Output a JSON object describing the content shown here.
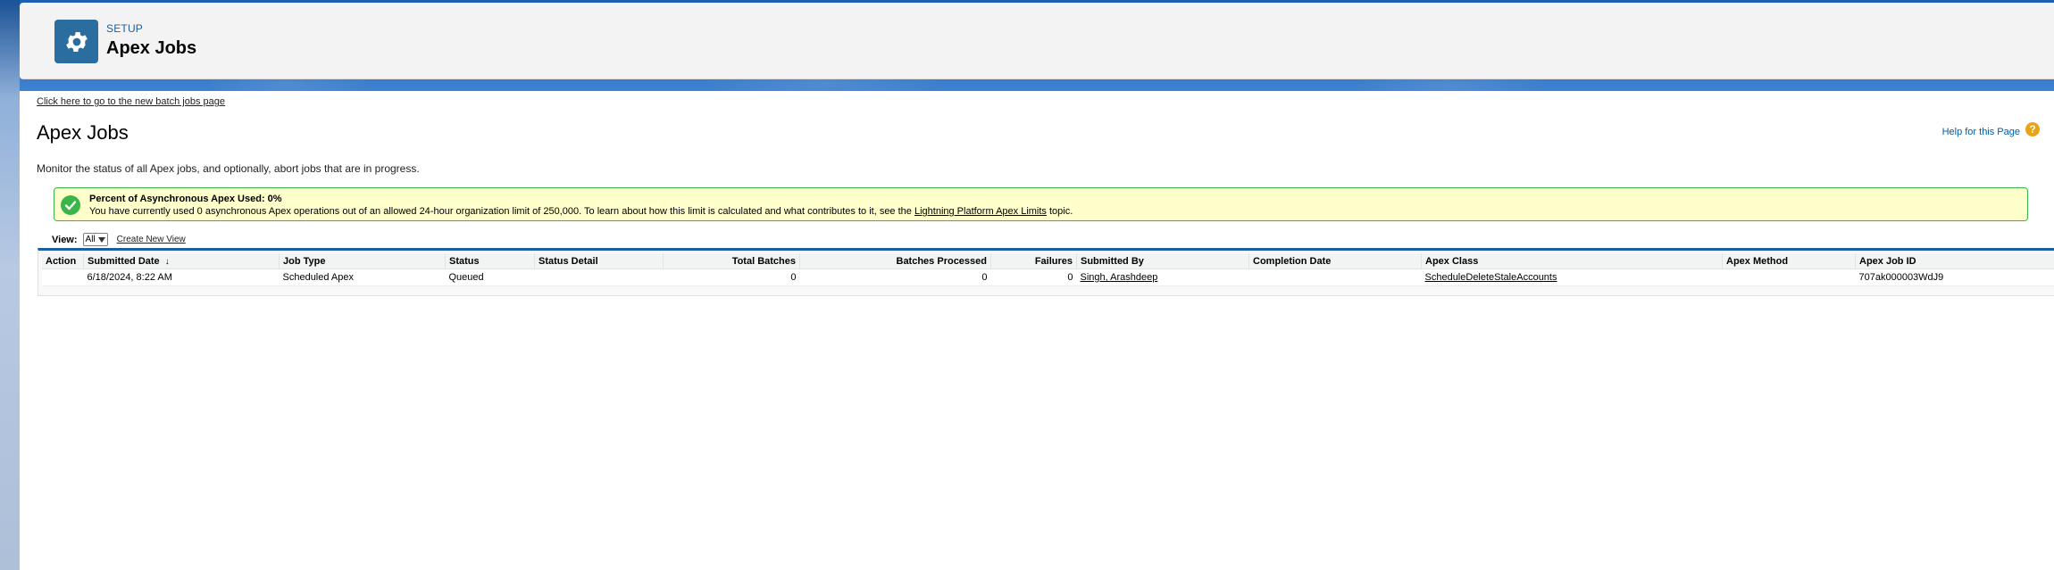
{
  "header": {
    "breadcrumb": "SETUP",
    "title": "Apex Jobs"
  },
  "links": {
    "batch_jobs": "Click here to go to the new batch jobs page",
    "help": "Help for this Page"
  },
  "page": {
    "title": "Apex Jobs",
    "description": "Monitor the status of all Apex jobs, and optionally, abort jobs that are in progress."
  },
  "info": {
    "title": "Percent of Asynchronous Apex Used: 0%",
    "text_before": "You have currently used 0 asynchronous Apex operations out of an allowed 24-hour organization limit of 250,000. To learn about how this limit is calculated and what contributes to it, see the ",
    "link": "Lightning Platform Apex Limits",
    "text_after": " topic."
  },
  "view": {
    "label": "View:",
    "selected": "All",
    "create_link": "Create New View"
  },
  "table": {
    "headers": {
      "action": "Action",
      "submitted_date": "Submitted Date",
      "job_type": "Job Type",
      "status": "Status",
      "status_detail": "Status Detail",
      "total_batches": "Total Batches",
      "batches_processed": "Batches Processed",
      "failures": "Failures",
      "submitted_by": "Submitted By",
      "completion_date": "Completion Date",
      "apex_class": "Apex Class",
      "apex_method": "Apex Method",
      "apex_job_id": "Apex Job ID"
    },
    "rows": [
      {
        "action": "",
        "submitted_date": "6/18/2024, 8:22 AM",
        "job_type": "Scheduled Apex",
        "status": "Queued",
        "status_detail": "",
        "total_batches": "0",
        "batches_processed": "0",
        "failures": "0",
        "submitted_by": "Singh, Arashdeep",
        "completion_date": "",
        "apex_class": "ScheduleDeleteStaleAccounts",
        "apex_method": "",
        "apex_job_id": "707ak000003WdJ9"
      }
    ]
  },
  "colors": {
    "brand_blue": "#1b5f9e",
    "success_green": "#39b54a",
    "info_bg": "#ffffcc"
  }
}
